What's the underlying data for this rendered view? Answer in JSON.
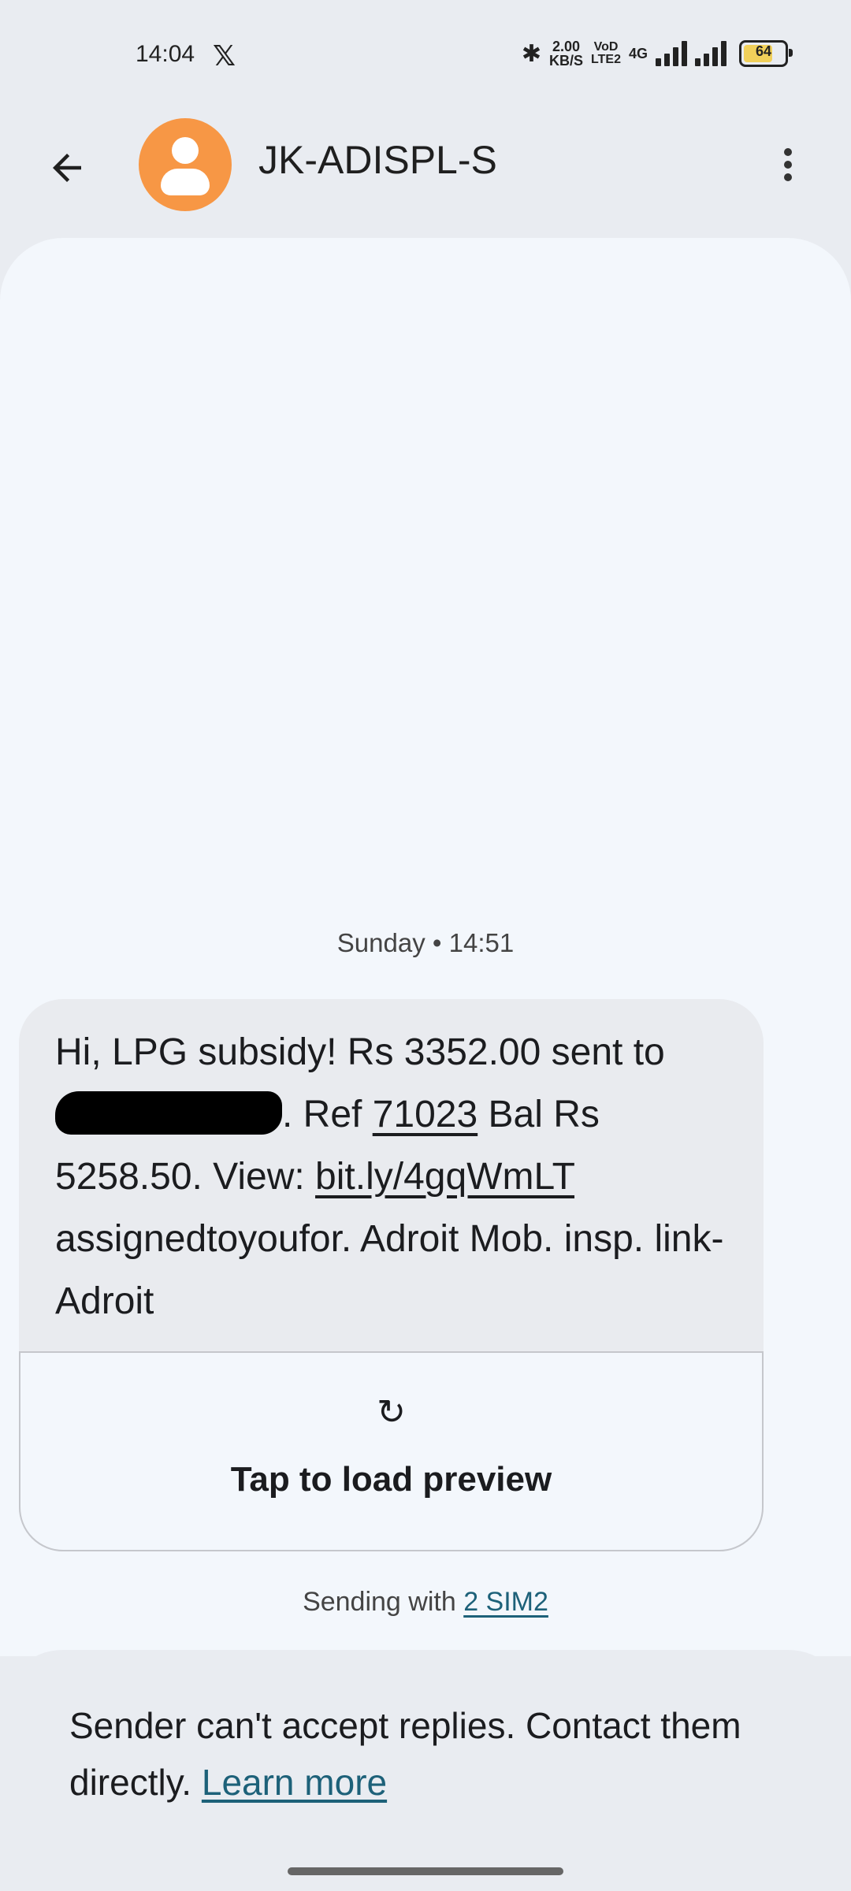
{
  "status": {
    "time": "14:04",
    "app_icon": "x-logo",
    "speed_top": "2.00",
    "speed_bottom": "KB/S",
    "volte_top": "VoD",
    "volte_bottom": "LTE2",
    "network": "4G",
    "battery": "64"
  },
  "header": {
    "contact_name": "JK-ADISPL-S"
  },
  "conversation": {
    "date_label": "Sunday • 14:51",
    "message": {
      "part1": "Hi, LPG subsidy! Rs 3352.00 sent to ",
      "part2": ". Ref ",
      "ref": "71023",
      "part3": " Bal Rs 5258.50. View: ",
      "link": "bit.ly/4gqWmLT",
      "part4": " assignedtoyoufor. Adroit Mob. insp. link- Adroit"
    },
    "preview_label": "Tap to load preview",
    "sending_prefix": "Sending with ",
    "sim_label": "2 SIM2"
  },
  "footer": {
    "notice": "Sender can't accept replies. Contact them directly. ",
    "learn_more": "Learn more"
  }
}
